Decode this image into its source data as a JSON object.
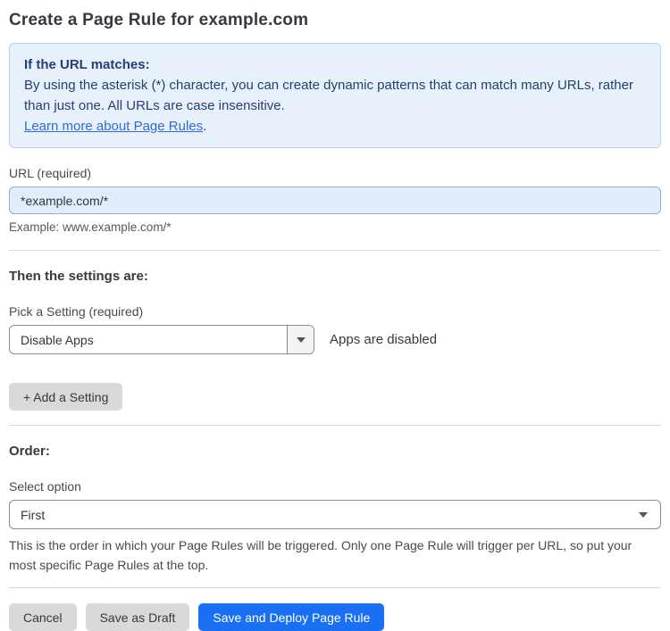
{
  "page": {
    "title": "Create a Page Rule for example.com"
  },
  "info_box": {
    "heading": "If the URL matches:",
    "body": "By using the asterisk (*) character, you can create dynamic patterns that can match many URLs, rather than just one. All URLs are case insensitive.",
    "link_text": "Learn more about Page Rules",
    "link_suffix": "."
  },
  "url_field": {
    "label": "URL (required)",
    "value": "*example.com/*",
    "example": "Example: www.example.com/*"
  },
  "settings_section": {
    "heading": "Then the settings are:",
    "picker_label": "Pick a Setting (required)",
    "picker_value": "Disable Apps",
    "picker_description": "Apps are disabled",
    "add_setting_label": "+ Add a Setting"
  },
  "order_section": {
    "heading": "Order:",
    "select_label": "Select option",
    "select_value": "First",
    "description": "This is the order in which your Page Rules will be triggered. Only one Page Rule will trigger per URL, so put your most specific Page Rules at the top."
  },
  "actions": {
    "cancel_label": "Cancel",
    "save_draft_label": "Save as Draft",
    "save_deploy_label": "Save and Deploy Page Rule"
  },
  "colors": {
    "info_bg": "#e8f1fb",
    "info_border": "#b8d2ef",
    "info_text": "#253e76",
    "link_blue": "#2f6bd9",
    "input_bg": "#e2ecfa",
    "primary_button_blue": "#1a6ff2",
    "secondary_button_gray": "#d9d9d9"
  }
}
